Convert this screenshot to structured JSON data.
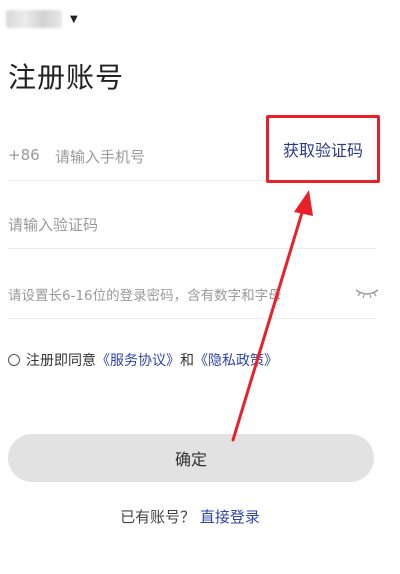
{
  "header": {
    "dropdown_icon": "caret-down-icon"
  },
  "title": "注册账号",
  "phone": {
    "prefix": "+86",
    "placeholder": "请输入手机号",
    "get_code_label": "获取验证码"
  },
  "code": {
    "placeholder": "请输入验证码"
  },
  "password": {
    "placeholder": "请设置长6-16位的登录密码，含有数字和字母",
    "toggle_icon": "eye-closed-icon"
  },
  "agreement": {
    "prefix": "注册即同意",
    "service": "《服务协议》",
    "and": "和",
    "privacy": "《隐私政策》"
  },
  "confirm_label": "确定",
  "login": {
    "prompt": "已有账号？",
    "link": "直接登录"
  },
  "colors": {
    "accent": "#2f46a8",
    "annotation": "#e8202a",
    "button_bg": "#e2e2e2"
  }
}
